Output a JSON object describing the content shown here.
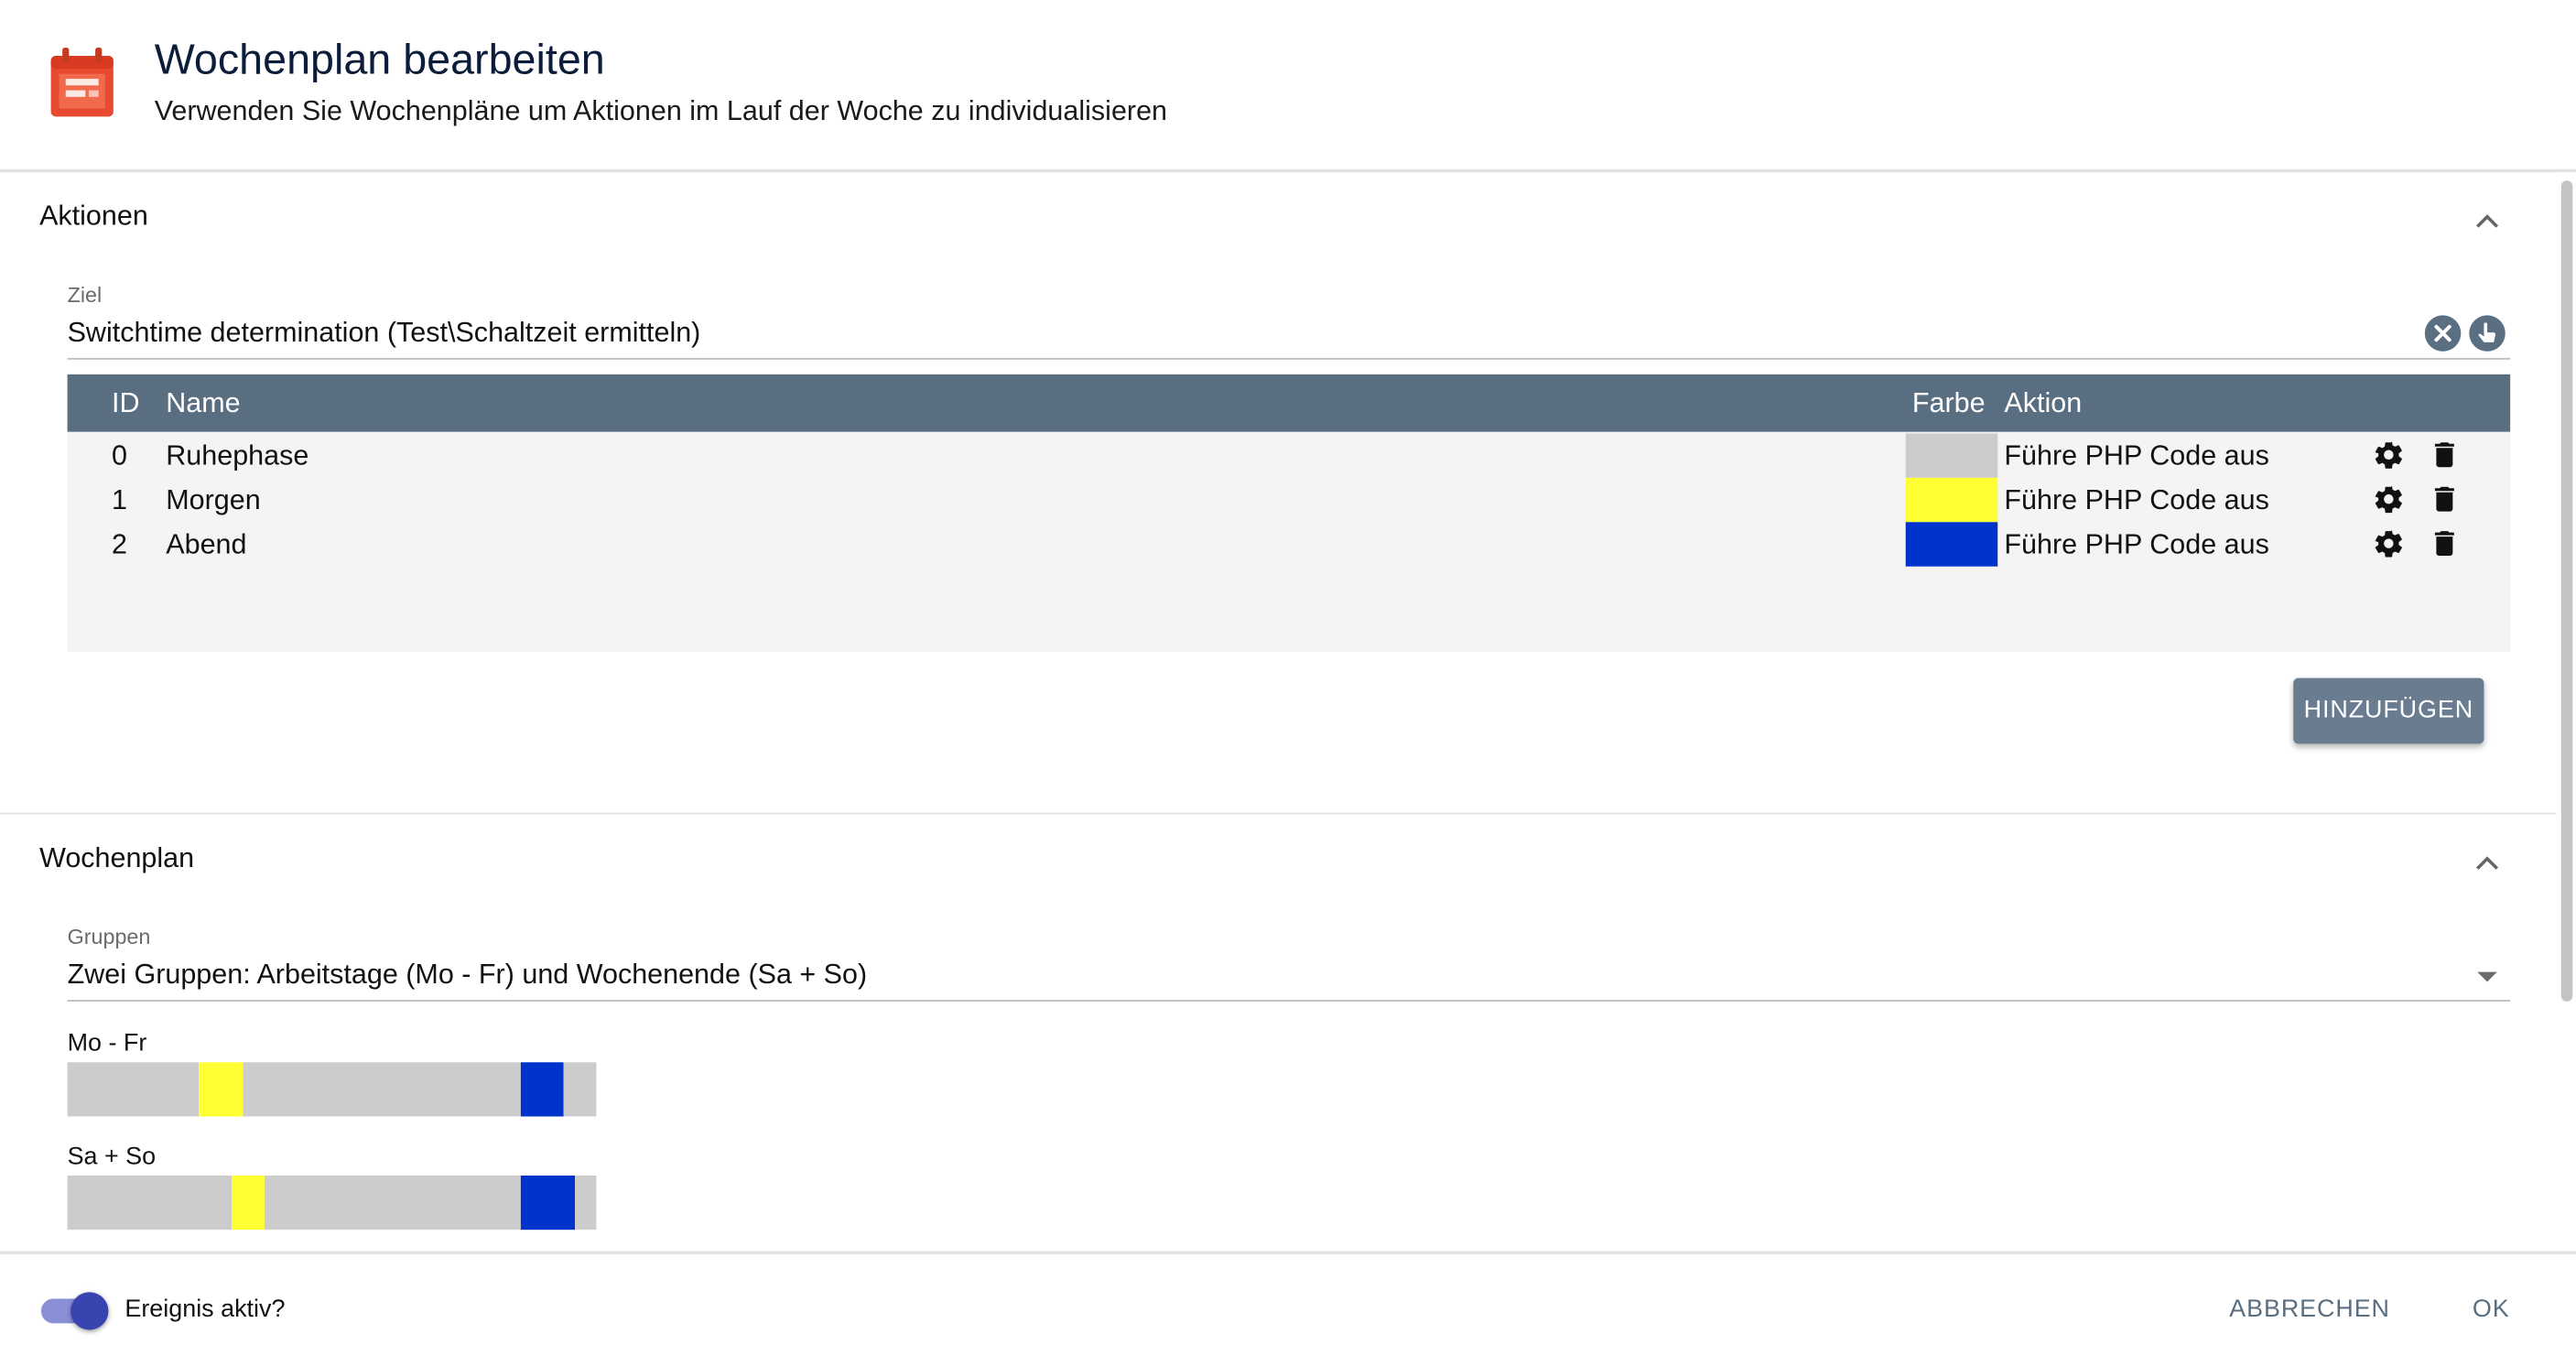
{
  "header": {
    "title": "Wochenplan bearbeiten",
    "subtitle": "Verwenden Sie Wochenpläne um Aktionen im Lauf der Woche zu individualisieren",
    "icon": "calendar-icon",
    "icon_color": "#e84a2f"
  },
  "actions_section": {
    "title": "Aktionen",
    "target_label": "Ziel",
    "target_value": "Switchtime determination (Test\\Schaltzeit ermitteln)",
    "table": {
      "headers": {
        "id": "ID",
        "name": "Name",
        "color": "Farbe",
        "action": "Aktion"
      },
      "rows": [
        {
          "id": "0",
          "name": "Ruhephase",
          "color": "#cccccc",
          "action": "Führe PHP Code aus"
        },
        {
          "id": "1",
          "name": "Morgen",
          "color": "#ffff33",
          "action": "Führe PHP Code aus"
        },
        {
          "id": "2",
          "name": "Abend",
          "color": "#0033cc",
          "action": "Führe PHP Code aus"
        }
      ]
    },
    "add_button": "HINZUFÜGEN"
  },
  "schedule_section": {
    "title": "Wochenplan",
    "groups_label": "Gruppen",
    "groups_value": "Zwei Gruppen: Arbeitstage (Mo - Fr) und Wochenende (Sa + So)",
    "timelines": [
      {
        "label": "Mo - Fr",
        "segments": [
          {
            "action_id": 0,
            "start_fraction": 0.0,
            "end_fraction": 0.248
          },
          {
            "action_id": 1,
            "start_fraction": 0.248,
            "end_fraction": 0.332
          },
          {
            "action_id": 0,
            "start_fraction": 0.332,
            "end_fraction": 0.857
          },
          {
            "action_id": 2,
            "start_fraction": 0.857,
            "end_fraction": 0.938
          },
          {
            "action_id": 0,
            "start_fraction": 0.938,
            "end_fraction": 1.0
          }
        ]
      },
      {
        "label": "Sa + So",
        "segments": [
          {
            "action_id": 0,
            "start_fraction": 0.0,
            "end_fraction": 0.311
          },
          {
            "action_id": 1,
            "start_fraction": 0.311,
            "end_fraction": 0.373
          },
          {
            "action_id": 0,
            "start_fraction": 0.373,
            "end_fraction": 0.857
          },
          {
            "action_id": 2,
            "start_fraction": 0.857,
            "end_fraction": 0.96
          },
          {
            "action_id": 0,
            "start_fraction": 0.96,
            "end_fraction": 1.0
          }
        ]
      }
    ]
  },
  "footer": {
    "toggle_label": "Ereignis aktiv?",
    "toggle_on": true,
    "cancel_button": "ABBRECHEN",
    "ok_button": "OK"
  },
  "colors": {
    "table_header": "#5a6e82",
    "accent": "#3844b0"
  }
}
